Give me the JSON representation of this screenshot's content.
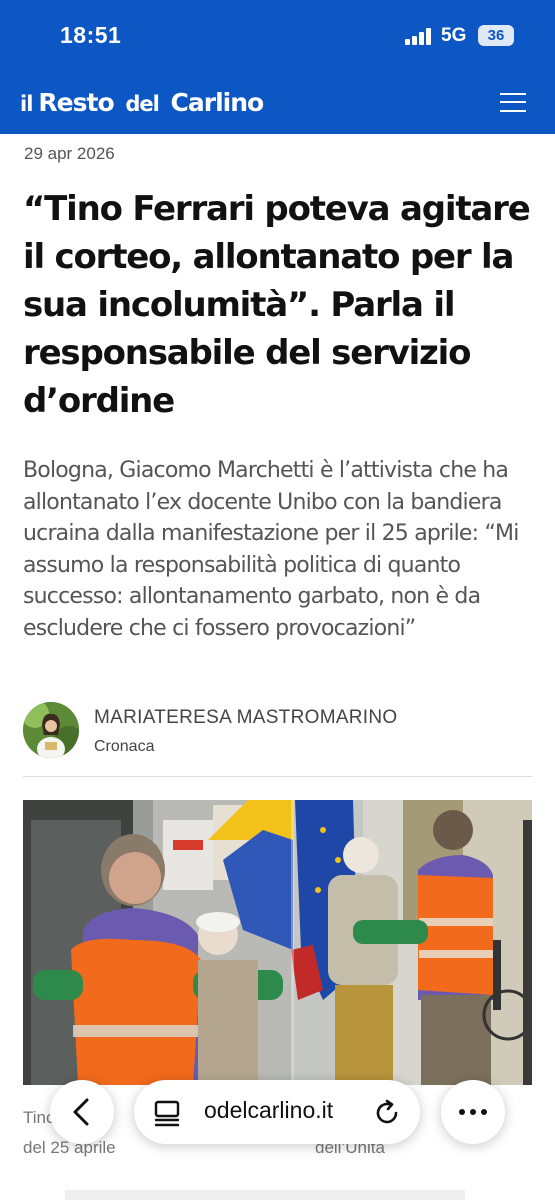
{
  "status_bar": {
    "time": "18:51",
    "network": "5G",
    "battery": "36"
  },
  "header": {
    "logo_il": "il",
    "logo_resto": "Resto",
    "logo_del": "del",
    "logo_carlino": "Carlino",
    "brand_color": "#0d57c4"
  },
  "article": {
    "date": "29 apr 2026",
    "headline": "“Tino Ferrari poteva agitare il corteo, allontanato per la sua incolumità”. Parla il responsabile del servizio d’ordine",
    "subtitle": "Bologna, Giacomo Marchetti è l’attivista che ha allontanato l’ex docente Unibo con la bandiera ucraina dalla manifestazione per il 25 aprile: “Mi assumo la responsabilità politica di quanto successo: allontanamento garbato, non è da escludere che ci fossero provocazioni”",
    "author": "MARIATERESA MASTROMARINO",
    "section": "Cronaca",
    "caption_start": "Tino Ferrari",
    "caption_mid": "o",
    "caption_line2_start": "del 25 aprile",
    "caption_line2_end": "dell’Unità"
  },
  "browser": {
    "url": "odelcarlino.it"
  },
  "icons": {
    "menu": "hamburger-menu-icon",
    "back": "chevron-left-icon",
    "tabs": "tabs-icon",
    "reload": "reload-icon",
    "more": "ellipsis-icon"
  }
}
